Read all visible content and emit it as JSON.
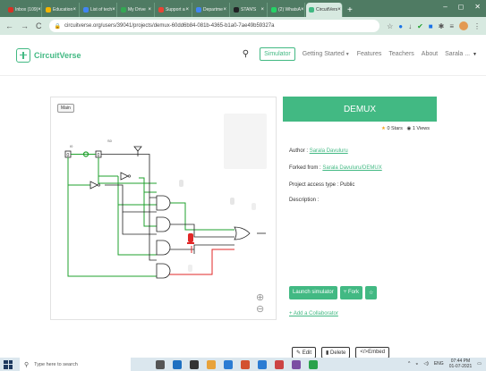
{
  "browser": {
    "tabs": [
      {
        "label": "Inbox (109)",
        "color": "#d93025"
      },
      {
        "label": "Education",
        "color": "#f4b400"
      },
      {
        "label": "List of tech",
        "color": "#4285f4"
      },
      {
        "label": "My Drive",
        "color": "#34a853"
      },
      {
        "label": "Support a",
        "color": "#ea4335"
      },
      {
        "label": "Departme",
        "color": "#4285f4"
      },
      {
        "label": "STAN'S",
        "color": "#202124"
      },
      {
        "label": "(2) WhatsA",
        "color": "#25d366"
      },
      {
        "label": "CircuitVers",
        "color": "#42b983",
        "active": true
      }
    ],
    "new_tab": "+",
    "url": "circuitverse.org/users/39041/projects/demux-60dd6b84-081b-4365-b1a0-7ae49b59327a"
  },
  "navbar": {
    "brand": "CircuitVerse",
    "simulator": "Simulator",
    "getting_started": "Getting Started",
    "features": "Features",
    "teachers": "Teachers",
    "about": "About",
    "user": "Sarala ..."
  },
  "circuit": {
    "main_tab": "Main",
    "label_in": "I0",
    "label_sel": "S0",
    "zoom_in": "⊕",
    "zoom_out": "⊖"
  },
  "project": {
    "title": "DEMUX",
    "stars": "0 Stars",
    "views": "1 Views",
    "author_label": "Author :",
    "author": "Sarala Davuluru",
    "forked_label": "Forked from :",
    "forked_from": "Sarala Davuluru/DEMUX",
    "access_label": "Project access type :",
    "access": "Public",
    "description_label": "Description :"
  },
  "actions": {
    "launch": "Launch simulator",
    "fork": "Fork",
    "star": "☆",
    "add_collab": "+ Add a Collaborator",
    "edit": "Edit",
    "delete": "Delete",
    "embed": "Embed"
  },
  "taskbar": {
    "search_placeholder": "Type here to search",
    "time": "07:44 PM",
    "date": "01-07-2021",
    "lang": "ENG"
  },
  "colors": {
    "brand": "#42b983",
    "wire_on": "#1fa02c",
    "wire_off": "#e12727",
    "wire_neutral": "#222222"
  }
}
